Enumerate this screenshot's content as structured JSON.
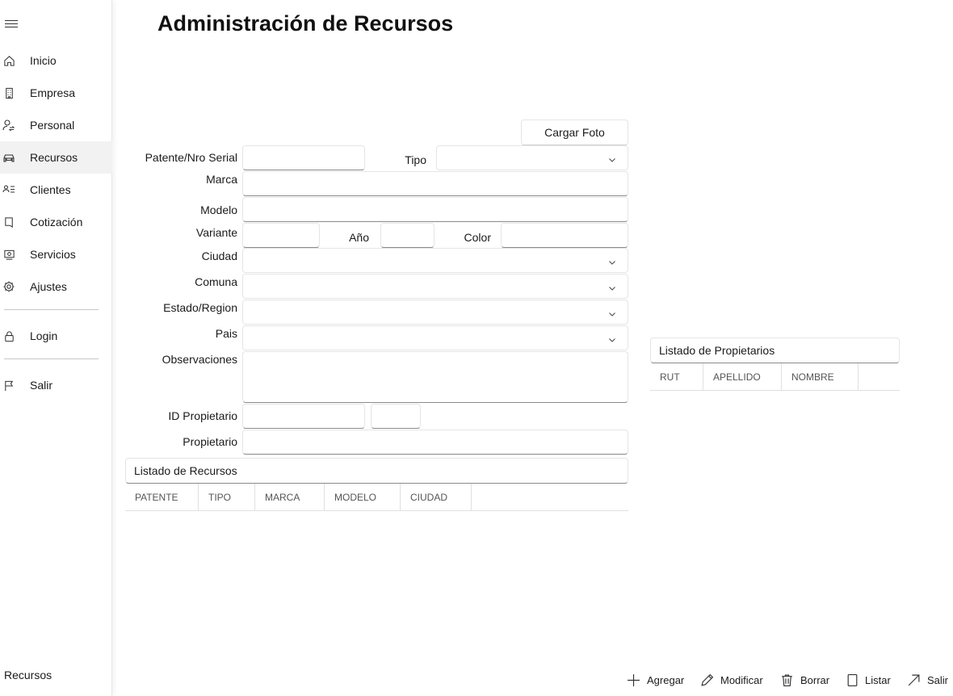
{
  "app": {
    "title": "Administración de Recursos",
    "footer_label": "Recursos"
  },
  "sidebar": {
    "items": [
      {
        "label": "Inicio",
        "icon": "home-icon"
      },
      {
        "label": "Empresa",
        "icon": "building-icon"
      },
      {
        "label": "Personal",
        "icon": "person-switch-icon"
      },
      {
        "label": "Recursos",
        "icon": "car-icon",
        "active": true
      },
      {
        "label": "Clientes",
        "icon": "contact-list-icon"
      },
      {
        "label": "Cotización",
        "icon": "document-icon"
      },
      {
        "label": "Servicios",
        "icon": "screen-icon"
      },
      {
        "label": "Ajustes",
        "icon": "gear-icon"
      },
      {
        "label": "Login",
        "icon": "lock-icon"
      },
      {
        "label": "Salir",
        "icon": "flag-icon"
      }
    ]
  },
  "form": {
    "load_photo_button": "Cargar Foto",
    "patente_label": "Patente/Nro Serial",
    "patente_value": "",
    "tipo_label": "Tipo",
    "tipo_value": "",
    "marca_label": "Marca",
    "marca_value": "",
    "modelo_label": "Modelo",
    "modelo_value": "",
    "variante_label": "Variante",
    "variante_value": "",
    "anio_label": "Año",
    "anio_value": "",
    "color_label": "Color",
    "color_value": "",
    "ciudad_label": "Ciudad",
    "ciudad_value": "",
    "comuna_label": "Comuna",
    "comuna_value": "",
    "estado_label": "Estado/Region",
    "estado_value": "",
    "pais_label": "Pais",
    "pais_value": "",
    "observaciones_label": "Observaciones",
    "observaciones_value": "",
    "id_propietario_label": "ID Propietario",
    "id_propietario_value": "",
    "id_propietario_extra_value": "",
    "propietario_label": "Propietario",
    "propietario_value": ""
  },
  "recursos_list": {
    "title": "Listado de Recursos",
    "columns": [
      "PATENTE",
      "TIPO",
      "MARCA",
      "MODELO",
      "CIUDAD"
    ]
  },
  "propietarios_list": {
    "title": "Listado de Propietarios",
    "columns": [
      "RUT",
      "APELLIDO",
      "NOMBRE"
    ]
  },
  "commands": [
    {
      "label": "Agregar",
      "icon": "plus-icon"
    },
    {
      "label": "Modificar",
      "icon": "pencil-icon"
    },
    {
      "label": "Borrar",
      "icon": "trash-icon"
    },
    {
      "label": "Listar",
      "icon": "page-icon"
    },
    {
      "label": "Salir",
      "icon": "arrow-up-right-icon"
    }
  ]
}
